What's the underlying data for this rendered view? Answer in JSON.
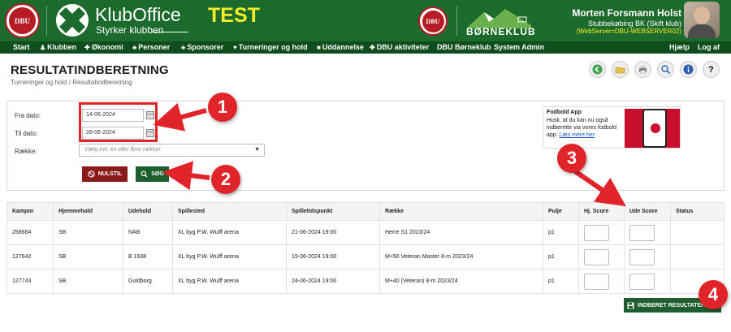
{
  "header": {
    "dbu_logo_text": "DBU",
    "app_name": "KlubOffice",
    "app_tagline": "Styrker klubben",
    "env_label": "TEST",
    "dbu_logo2_text": "DBU",
    "brand_bk": "BØRNEKLUB",
    "user_name": "Morten Forsmann Holst",
    "user_club": "Stubbekøbing BK (Skift klub)",
    "user_server": "(WebServer=DBU-WEBSERVER02)"
  },
  "nav": {
    "start": "Start",
    "klubben": "Klubben",
    "okonomi": "Økonomi",
    "personer": "Personer",
    "sponsorer": "Sponsorer",
    "turneringer": "Turneringer og hold",
    "uddannelse": "Uddannelse",
    "dbu_aktiviteter": "DBU aktiviteter",
    "dbu_borneklub": "DBU Børneklub",
    "system_admin": "System Admin",
    "hjaelp": "Hjælp",
    "log_af": "Log af"
  },
  "page": {
    "title": "RESULTATINDBERETNING",
    "breadcrumb": "Turneringer og hold / Resultatindberetning"
  },
  "toolbar_icons": [
    "back-icon",
    "folder-icon",
    "print-icon",
    "search-icon",
    "info-icon",
    "help-icon"
  ],
  "toolbar_help_glyph": "?",
  "search": {
    "from_label": "Fra dato:",
    "from_value": "14-06-2024",
    "to_label": "Til dato:",
    "to_value": "28-06-2024",
    "row_label": "Række:",
    "row_placeholder": "Vælg evt. en eller flere rækker",
    "reset_label": "NULSTIL",
    "search_label": "SØG"
  },
  "promo": {
    "title": "Fodbold App",
    "text": "Husk, at du kan nu også indberette via vores fodbold app.",
    "link": "Læs mere her"
  },
  "table": {
    "headers": [
      "Kampnr",
      "Hjemmehold",
      "Udehold",
      "Spillested",
      "Spilletidspunkt",
      "Række",
      "Pulje",
      "Hj. Score",
      "Ude Score",
      "Status"
    ],
    "rows": [
      [
        "258664",
        "SB",
        "NAB",
        "XL byg P.W. Wulff arena",
        "21-06-2024 19:00",
        "Herre S1 2023/24",
        "p1"
      ],
      [
        "127642",
        "SB",
        "B 1938",
        "XL byg P.W. Wulff arena",
        "19-06-2024 19:00",
        "M+50 Veteran Master 8-m 2023/24",
        "p1"
      ],
      [
        "127743",
        "SB",
        "Guldborg",
        "XL byg P.W. Wulff arena",
        "24-06-2024 19:00",
        "M+40 (Veteran) 8-m 2023/24",
        "p1"
      ]
    ]
  },
  "submit_label": "INDBERET RESULTATER",
  "annotations": [
    "1",
    "2",
    "3",
    "4"
  ],
  "colors": {
    "brand_green": "#1d6b2c",
    "nav_green": "#0f4d1c",
    "accent_yellow": "#f4ee2a",
    "annotation_red": "#e0242a",
    "button_red": "#8b1a1a"
  }
}
